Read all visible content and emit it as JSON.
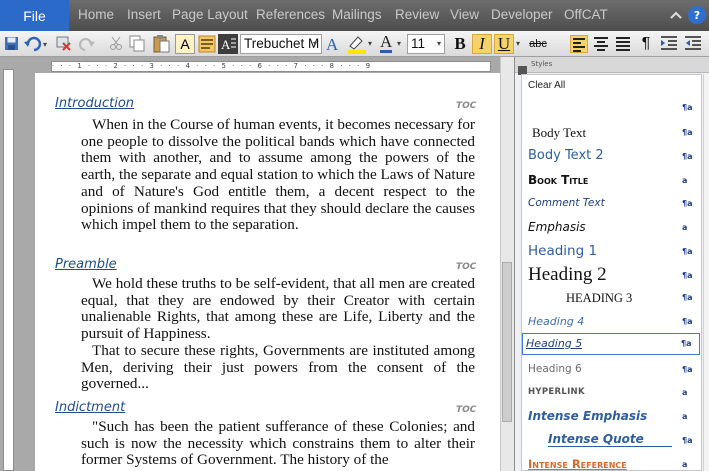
{
  "ribbon": {
    "file_tab": "File",
    "tabs": [
      "Home",
      "Insert",
      "Page Layout",
      "References",
      "Mailings",
      "Review",
      "View",
      "Developer",
      "OffCAT"
    ]
  },
  "toolbar": {
    "font_name": "Trebuchet M",
    "font_size": "11",
    "bold": "B",
    "italic": "I",
    "underline": "U",
    "strike": "abc",
    "pilcrow": "¶",
    "font_color_letter": "A",
    "highlight_letter": "A"
  },
  "document": {
    "sections": [
      {
        "heading": "Introduction",
        "toc": "TOC",
        "paragraphs": [
          "When in the Course of human events, it becomes necessary for one people to dissolve the political bands which have connected them with another, and to assume among the powers of the earth, the separate and equal station to which the Laws of Nature and of Nature's God entitle them, a decent respect to the opinions of mankind requires that they should declare the causes which impel them to the separation."
        ]
      },
      {
        "heading": "Preamble",
        "toc": "TOC",
        "paragraphs": [
          "We hold these truths to be self-evident, that all men are created equal, that they are endowed by their Creator with certain unalienable Rights, that among these are Life, Liberty and the pursuit of Happiness.",
          "That to secure these rights, Governments are instituted among Men, deriving their just powers from the consent of the governed..."
        ]
      },
      {
        "heading": "Indictment",
        "toc": "TOC",
        "paragraphs": [
          "\"Such has been the patient sufferance of these Colonies; and such is now the necessity which constrains them to alter their former Systems of Government. The history of the"
        ]
      }
    ]
  },
  "styles_pane": {
    "title": "Styles",
    "items": [
      {
        "label": "Clear All",
        "mark": ""
      },
      {
        "label": "",
        "mark": "¶a"
      },
      {
        "label": "Body Text",
        "mark": "¶a"
      },
      {
        "label": "Body Text 2",
        "mark": "¶a"
      },
      {
        "label": "Book Title",
        "mark": "a"
      },
      {
        "label": "Comment Text",
        "mark": "¶a"
      },
      {
        "label": "Emphasis",
        "mark": "a"
      },
      {
        "label": "Heading 1",
        "mark": "¶a"
      },
      {
        "label": "Heading 2",
        "mark": "¶a"
      },
      {
        "label": "HEADING 3",
        "mark": "¶a"
      },
      {
        "label": "Heading 4",
        "mark": "¶a"
      },
      {
        "label": "Heading 5",
        "mark": "¶a"
      },
      {
        "label": "Heading 6",
        "mark": "¶a"
      },
      {
        "label": "HYPERLINK",
        "mark": "a"
      },
      {
        "label": "Intense Emphasis",
        "mark": "a"
      },
      {
        "label": "Intense Quote",
        "mark": "¶a"
      },
      {
        "label": "Intense Reference",
        "mark": "a"
      }
    ]
  },
  "colors": {
    "file_tab": "#2b6ac9",
    "heading_blue": "#1f4e8c",
    "highlight_active": "#f5d36a"
  }
}
